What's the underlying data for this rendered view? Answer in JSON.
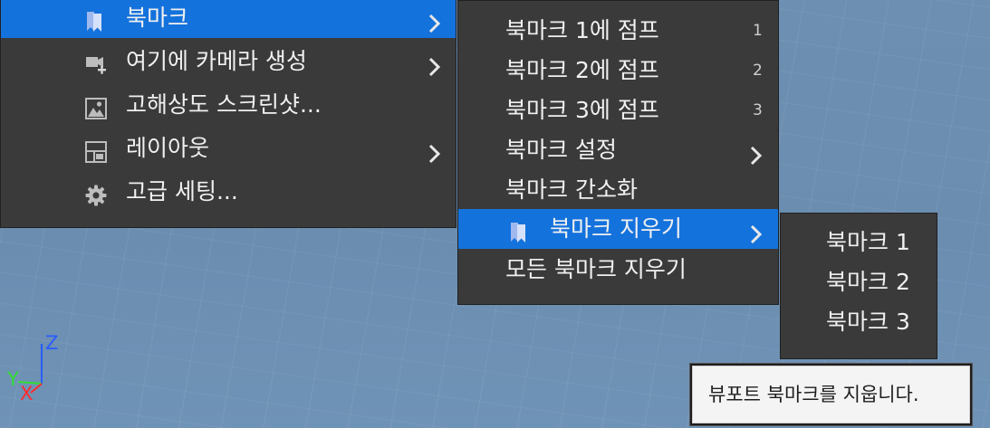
{
  "main_menu": {
    "items": [
      {
        "label": "북마크",
        "icon": "bookmark-icon",
        "has_submenu": true,
        "active": true
      },
      {
        "label": "여기에 카메라 생성",
        "icon": "camera-add-icon",
        "has_submenu": true
      },
      {
        "label": "고해상도 스크린샷...",
        "icon": "image-icon",
        "has_submenu": false
      },
      {
        "label": "레이아웃",
        "icon": "layout-icon",
        "has_submenu": true
      },
      {
        "label": "고급 세팅...",
        "icon": "gear-icon",
        "has_submenu": false
      }
    ]
  },
  "bookmark_menu": {
    "items": [
      {
        "label": "북마크 1에 점프",
        "shortcut": "1"
      },
      {
        "label": "북마크 2에 점프",
        "shortcut": "2"
      },
      {
        "label": "북마크 3에 점프",
        "shortcut": "3"
      },
      {
        "label": "북마크 설정",
        "has_submenu": true
      },
      {
        "label": "북마크 간소화"
      },
      {
        "label": "북마크 지우기",
        "icon": "bookmark-icon",
        "has_submenu": true,
        "active": true
      },
      {
        "label": "모든 북마크 지우기"
      }
    ]
  },
  "clear_bookmark_menu": {
    "items": [
      {
        "label": "북마크 1"
      },
      {
        "label": "북마크 2"
      },
      {
        "label": "북마크 3"
      }
    ]
  },
  "tooltip": {
    "text": "뷰포트 북마크를 지웁니다."
  },
  "gizmo": {
    "axis_z": "Z",
    "axis_y": "Y",
    "axis_x": "X",
    "colors": {
      "z": "#2a5dff",
      "y": "#33dd33",
      "x": "#ff2a2a"
    }
  },
  "colors": {
    "menu_bg": "#3a3a3a",
    "highlight": "#1472dc",
    "viewport_bg": "#6d8fb1"
  }
}
